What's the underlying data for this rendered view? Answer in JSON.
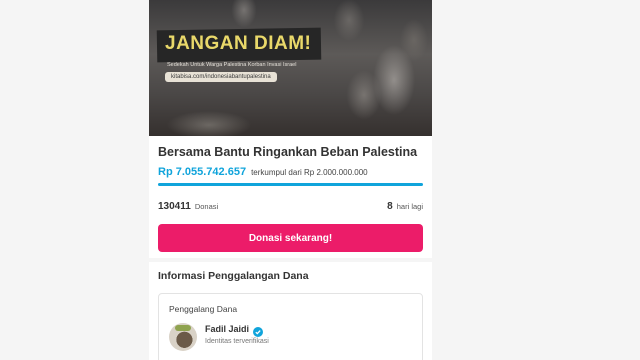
{
  "hero": {
    "headline": "JANGAN DIAM!",
    "subline": "Sedekah Untuk Warga Palestina Korban Invasi Israel",
    "url": "kitabisa.com/indonesiabantupalestina"
  },
  "campaign": {
    "title": "Bersama Bantu Ringankan Beban Palestina",
    "amount_collected": "Rp 7.055.742.657",
    "target_text": "terkumpul dari Rp 2.000.000.000",
    "progress_fraction": 1.0,
    "donation_count": "130411",
    "donation_label": "Donasi",
    "days_left": "8",
    "days_label": "hari lagi",
    "donate_button": "Donasi sekarang!"
  },
  "fundraising_info": {
    "section_title": "Informasi Penggalangan Dana",
    "fundraiser_label": "Penggalang Dana",
    "fundraiser_name": "Fadil Jaidi",
    "fundraiser_status": "Identitas terverifikasi"
  },
  "colors": {
    "accent_blue": "#10a4db",
    "donate_pink": "#ec1c69",
    "headline_yellow": "#e9d86a"
  },
  "icons": {
    "verified": "verified-badge-icon"
  }
}
